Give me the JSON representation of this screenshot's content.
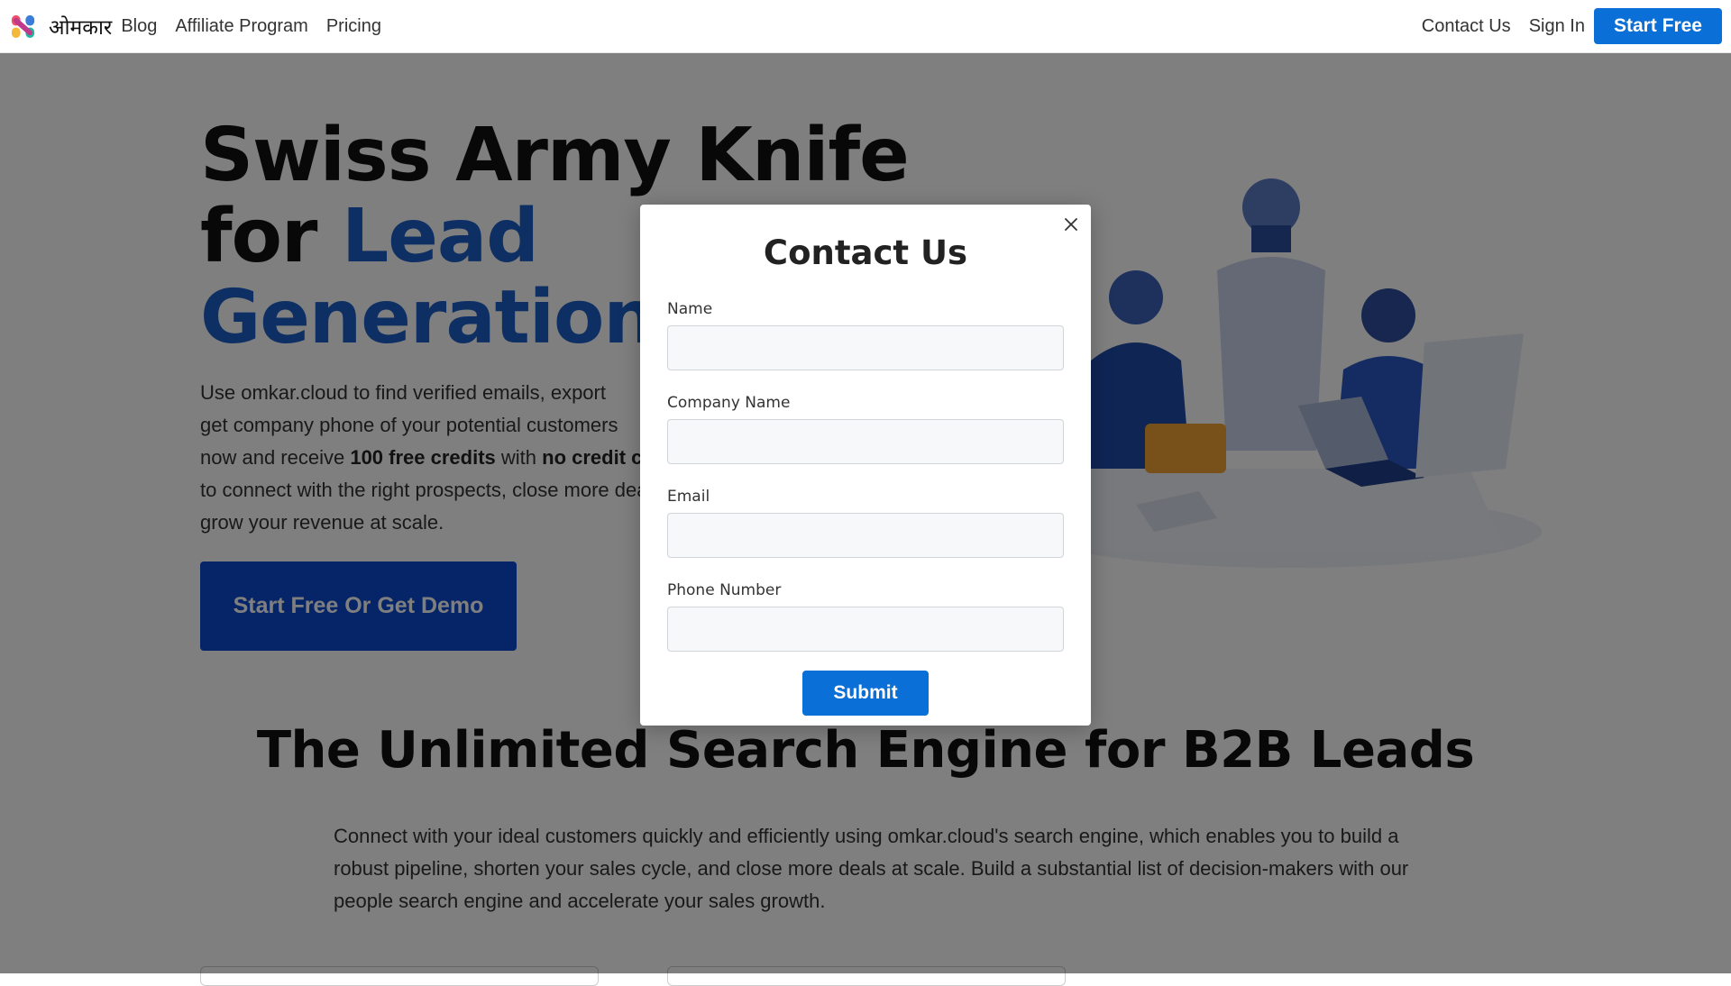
{
  "nav": {
    "brand": "ओमकार",
    "links": [
      "Blog",
      "Affiliate Program",
      "Pricing"
    ],
    "contact": "Contact Us",
    "signin": "Sign In",
    "start_free": "Start Free"
  },
  "hero": {
    "title_line1": "Swiss Army Knife",
    "title_for": "for ",
    "title_lead": "Lead",
    "title_generation": "Generation",
    "title_reg": "®",
    "desc_part1": "Use omkar.cloud to find verified emails, export",
    "desc_part2": "get company phone of your potential customers",
    "desc_part3a": "now and receive ",
    "desc_bold1": "100 free credits",
    "desc_part3b": " with ",
    "desc_bold2": "no credit card",
    "desc_part4": "to connect with the right prospects, close more deals and",
    "desc_part5": "grow your revenue at scale.",
    "cta": "Start Free Or Get Demo"
  },
  "section": {
    "title": "The Unlimited Search Engine for B2B Leads",
    "desc": "Connect with your ideal customers quickly and efficiently using omkar.cloud's search engine, which enables you to build a robust pipeline, shorten your sales cycle, and close more deals at scale. Build a substantial list of decision-makers with our people search engine and accelerate your sales growth."
  },
  "modal": {
    "title": "Contact Us",
    "fields": [
      {
        "label": "Name",
        "value": ""
      },
      {
        "label": "Company Name",
        "value": ""
      },
      {
        "label": "Email",
        "value": ""
      },
      {
        "label": "Phone Number",
        "value": ""
      }
    ],
    "submit": "Submit",
    "close_icon": "close-icon"
  },
  "colors": {
    "accent": "#0a6fd6",
    "hero_accent": "#1b5fc7",
    "cta": "#0a4bd1",
    "overlay": "rgba(0,0,0,0.5)"
  }
}
